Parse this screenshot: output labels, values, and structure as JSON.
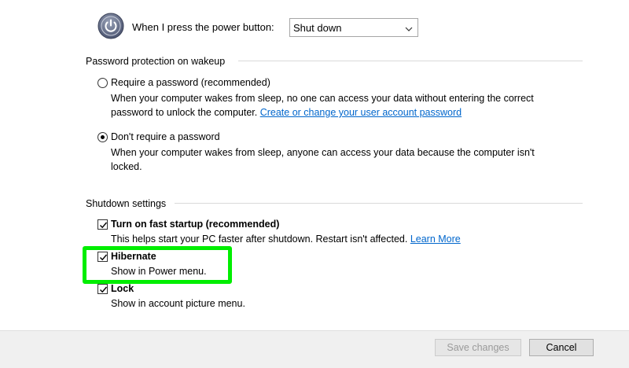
{
  "power_button": {
    "label": "When I press the power button:",
    "value": "Shut down",
    "icon": "power-icon"
  },
  "password": {
    "section_title": "Password protection on wakeup",
    "options": [
      {
        "label": "Require a password (recommended)",
        "selected": false,
        "desc_line1": "When your computer wakes from sleep, no one can access your data without entering the correct",
        "desc_line2_prefix": "password to unlock the computer.",
        "link": "Create or change your user account password"
      },
      {
        "label": "Don't require a password",
        "selected": true,
        "desc_line1": "When your computer wakes from sleep, anyone can access your data because the computer isn't",
        "desc_line2": "locked."
      }
    ]
  },
  "shutdown": {
    "section_title": "Shutdown settings",
    "items": [
      {
        "label": "Turn on fast startup (recommended)",
        "checked": true,
        "desc_prefix": "This helps start your PC faster after shutdown. Restart isn't affected.",
        "link": "Learn More"
      },
      {
        "label": "Hibernate",
        "checked": true,
        "desc": "Show in Power menu."
      },
      {
        "label": "Lock",
        "checked": true,
        "desc": "Show in account picture menu."
      }
    ]
  },
  "footer": {
    "save_label": "Save changes",
    "cancel_label": "Cancel"
  },
  "colors": {
    "highlight": "#00ee00",
    "link": "#0066cc"
  }
}
